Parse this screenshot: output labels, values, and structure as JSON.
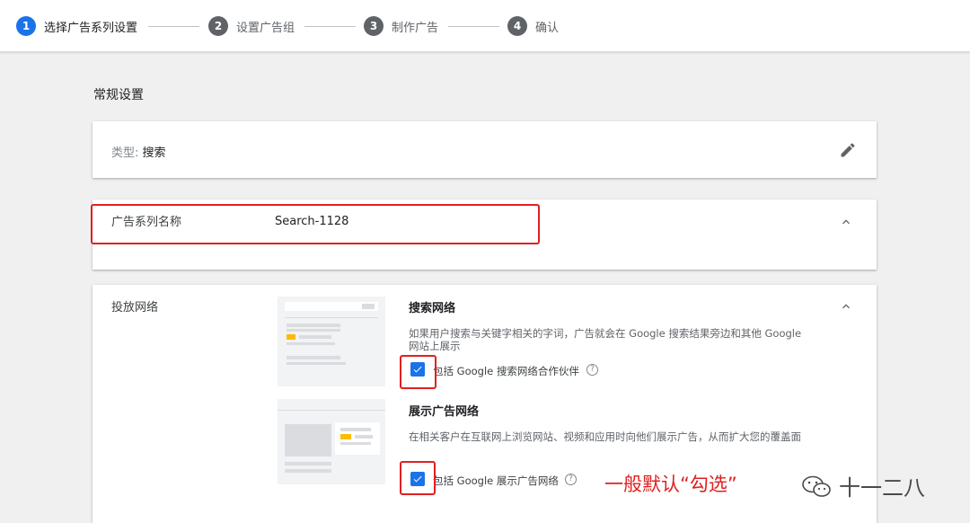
{
  "stepper": {
    "steps": [
      {
        "num": "1",
        "label": "选择广告系列设置"
      },
      {
        "num": "2",
        "label": "设置广告组"
      },
      {
        "num": "3",
        "label": "制作广告"
      },
      {
        "num": "4",
        "label": "确认"
      }
    ],
    "active_step": 1
  },
  "section": {
    "title": "常规设置"
  },
  "type_card": {
    "key": "类型:",
    "value": "搜索",
    "edit_icon": "pencil-icon"
  },
  "name_card": {
    "label": "广告系列名称",
    "value": "Search-1128",
    "chevron_icon": "chevron-up-icon"
  },
  "network_card": {
    "label": "投放网络",
    "chevron_icon": "chevron-up-icon",
    "search_network": {
      "title": "搜索网络",
      "description": "如果用户搜索与关键字相关的字词，广告就会在 Google 搜索结果旁边和其他 Google 网站上展示",
      "checkbox_label": "包括 Google 搜索网络合作伙伴",
      "checked": true,
      "help_icon": "?"
    },
    "display_network": {
      "title": "展示广告网络",
      "description": "在相关客户在互联网上浏览网站、视频和应用时向他们展示广告，从而扩大您的覆盖面",
      "checkbox_label": "包括 Google 展示广告网络",
      "checked": true,
      "help_icon": "?"
    }
  },
  "annotation": {
    "text": "一般默认“勾选”",
    "color": "#e02020"
  },
  "watermark": {
    "text": "十一二八",
    "icon": "wechat-icon"
  },
  "colors": {
    "accent": "#1a73e8",
    "annotation_red": "#e02020",
    "thumbnail_yellow": "#fbbc04"
  }
}
